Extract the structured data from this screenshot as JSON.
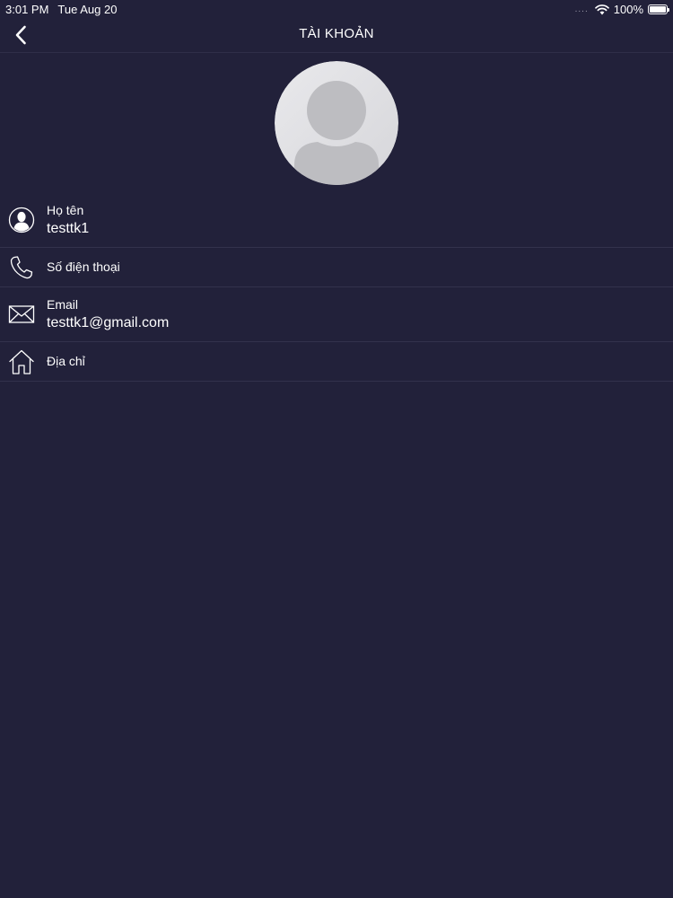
{
  "status_bar": {
    "time": "3:01 PM",
    "date": "Tue Aug 20",
    "signal": "....",
    "battery": "100%",
    "icons": [
      "wifi-icon",
      "battery-icon"
    ]
  },
  "nav": {
    "title": "TÀI KHOẢN",
    "back_icon": "chevron-left-icon"
  },
  "avatar": {
    "icon": "default-avatar-icon"
  },
  "profile": {
    "name": {
      "label": "Họ tên",
      "value": "testtk1",
      "icon": "user-icon"
    },
    "phone": {
      "label": "Số điện thoại",
      "value": "",
      "icon": "phone-icon"
    },
    "email": {
      "label": "Email",
      "value": "testtk1@gmail.com",
      "icon": "mail-icon"
    },
    "address": {
      "label": "Địa chỉ",
      "value": "",
      "icon": "home-icon"
    }
  },
  "colors": {
    "background": "#22213a",
    "divider": "#33324c",
    "text": "#ffffff"
  }
}
